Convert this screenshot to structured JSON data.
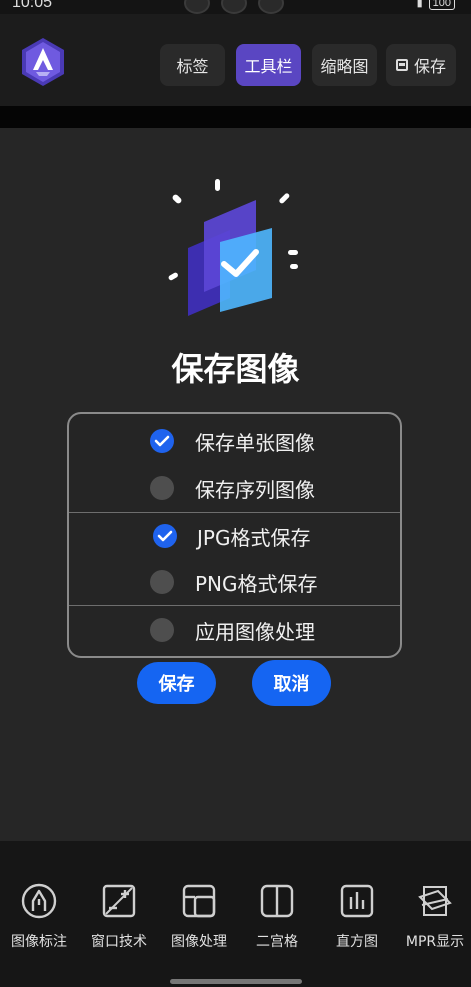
{
  "status_bar": {
    "time": "10:05",
    "battery": "100"
  },
  "header": {
    "tabs": [
      {
        "label": "标签",
        "active": false
      },
      {
        "label": "工具栏",
        "active": true
      },
      {
        "label": "缩略图",
        "active": false
      },
      {
        "label": "保存",
        "active": false,
        "icon": "save-icon"
      }
    ]
  },
  "dialog": {
    "title": "保存图像",
    "options": [
      {
        "label": "保存单张图像",
        "checked": true
      },
      {
        "label": "保存序列图像",
        "checked": false
      },
      {
        "label": "JPG格式保存",
        "checked": true
      },
      {
        "label": "PNG格式保存",
        "checked": false
      },
      {
        "label": "应用图像处理",
        "checked": false
      }
    ],
    "save_label": "保存",
    "cancel_label": "取消"
  },
  "toolbar": {
    "items": [
      {
        "label": "图像标注",
        "icon": "annotation-pen-icon"
      },
      {
        "label": "窗口技术",
        "icon": "window-level-icon"
      },
      {
        "label": "图像处理",
        "icon": "image-processing-icon"
      },
      {
        "label": "二宫格",
        "icon": "two-grid-icon"
      },
      {
        "label": "直方图",
        "icon": "histogram-icon"
      },
      {
        "label": "MPR显示",
        "icon": "mpr-icon"
      }
    ]
  },
  "colors": {
    "accent": "#1565f2",
    "active_tab": "#5a46c2",
    "check": "#1f63ee"
  }
}
